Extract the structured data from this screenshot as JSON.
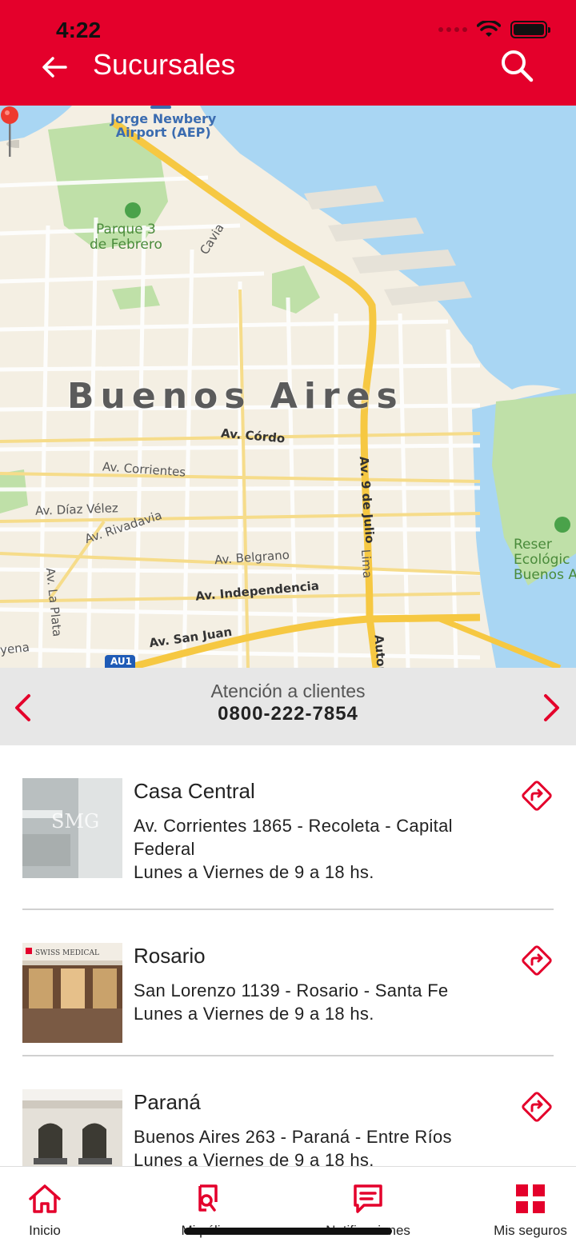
{
  "status_bar": {
    "time": "4:22"
  },
  "header": {
    "title": "Sucursales",
    "back_icon": "arrow-left-icon",
    "search_icon": "search-icon",
    "background_color": "#e4002b"
  },
  "map": {
    "labels": {
      "city": "Buenos Aires",
      "airport_line1": "Jorge Newbery",
      "airport_line2": "Airport (AEP)",
      "park_line1": "Parque 3",
      "park_line2": "de Febrero",
      "reserva_line1": "Reser",
      "reserva_line2": "Ecológic",
      "reserva_line3": "Buenos A",
      "cavia": "Cavia",
      "cordoba": "Av. Córdo",
      "corrientes": "Av. Corrientes",
      "diaz_velez": "Av. Díaz Vélez",
      "rivadavia": "Av. Rivadavia",
      "belgrano": "Av. Belgrano",
      "independencia": "Av. Independencia",
      "san_juan": "Av. San Juan",
      "la_plata": "Av. La Plata",
      "nueve_de_julio": "Av. 9 de Julio",
      "lima": "Lima",
      "autopista": "Autop",
      "jujuy_fragment": "yena",
      "au1": "AU1"
    }
  },
  "info_bar": {
    "caption": "Atención a clientes",
    "phone": "0800-222-7854",
    "prev_icon": "chevron-left-icon",
    "next_icon": "chevron-right-icon",
    "accent_color": "#e4002b"
  },
  "branches": [
    {
      "name": "Casa Central",
      "address": "Av. Corrientes 1865 - Recoleta - Capital Federal",
      "hours": "Lunes a Viernes de 9 a 18 hs.",
      "photo_sign": "SMG"
    },
    {
      "name": "Rosario",
      "address": "San Lorenzo 1139 - Rosario - Santa Fe",
      "hours": "Lunes a Viernes de 9 a 18 hs.",
      "photo_sign": "SWISS MEDICAL"
    },
    {
      "name": "Paraná",
      "address": "Buenos Aires  263 - Paraná - Entre Ríos",
      "hours": "Lunes a Viernes de 9 a 18 hs.",
      "photo_sign": ""
    }
  ],
  "tabbar": {
    "tabs": [
      {
        "label": "Inicio",
        "icon": "home-icon"
      },
      {
        "label": "Mi póliza",
        "icon": "policy-icon"
      },
      {
        "label": "Notificaciones",
        "icon": "message-icon"
      },
      {
        "label": "Mis seguros",
        "icon": "grid-icon"
      }
    ],
    "accent_color": "#e4002b"
  }
}
